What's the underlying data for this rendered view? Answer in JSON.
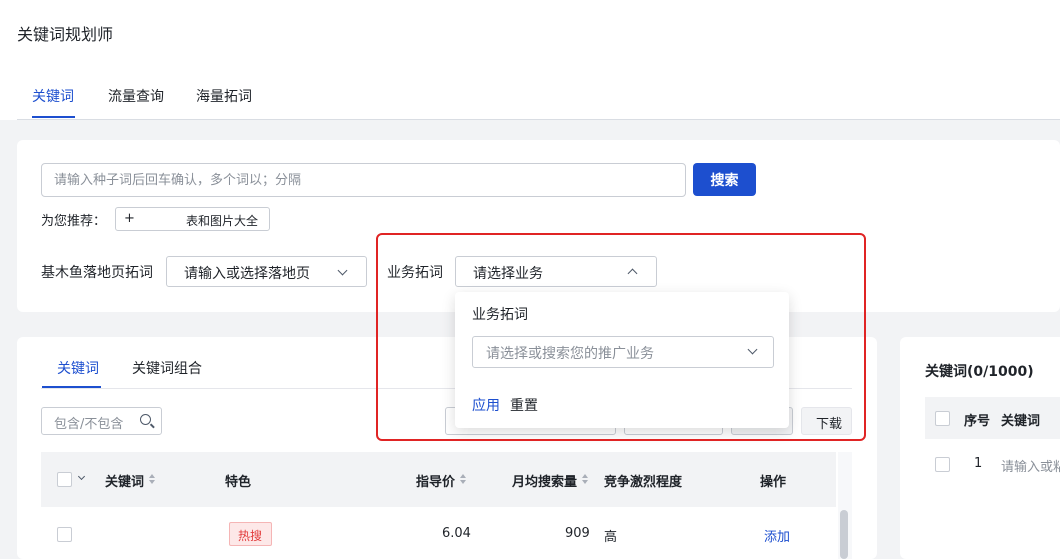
{
  "app": {
    "title": "关键词规划师"
  },
  "tabs": [
    {
      "label": "关键词",
      "active": true
    },
    {
      "label": "流量查询",
      "active": false
    },
    {
      "label": "海量拓词",
      "active": false
    }
  ],
  "search": {
    "placeholder": "请输入种子词后回车确认，多个词以；分隔",
    "button_label": "搜索",
    "recommend_label": "为您推荐：",
    "recommend_tag_icon": "+",
    "recommend_tag_text": "表和图片大全"
  },
  "landing_page": {
    "label": "基木鱼落地页拓词",
    "selected": "请输入或选择落地页"
  },
  "business": {
    "label": "业务拓词",
    "selected": "请选择业务",
    "dropdown": {
      "title": "业务拓词",
      "placeholder": "请选择或搜索您的推广业务",
      "apply_label": "应用",
      "reset_label": "重置"
    }
  },
  "keyword_tabs": [
    {
      "label": "关键词",
      "active": true
    },
    {
      "label": "关键词组合",
      "active": false
    }
  ],
  "filter": {
    "placeholder": "包含/不包含"
  },
  "download_label": "下载",
  "table": {
    "columns": [
      "关键词",
      "特色",
      "指导价",
      "月均搜索量",
      "竞争激烈程度",
      "操作"
    ],
    "rows": [
      {
        "keyword": "",
        "feature": "热搜",
        "price": "6.04",
        "monthly_search": "909",
        "competition": "高",
        "action": "添加"
      }
    ]
  },
  "right_panel": {
    "title": "关键词(0/1000)",
    "columns": [
      "序号",
      "关键词"
    ],
    "rows": [
      {
        "index": "1",
        "placeholder": "请输入或粘"
      }
    ]
  },
  "colors": {
    "accent": "#1d4fcf",
    "highlight_border": "#e02424",
    "hot_badge_text": "#e23b3b"
  }
}
